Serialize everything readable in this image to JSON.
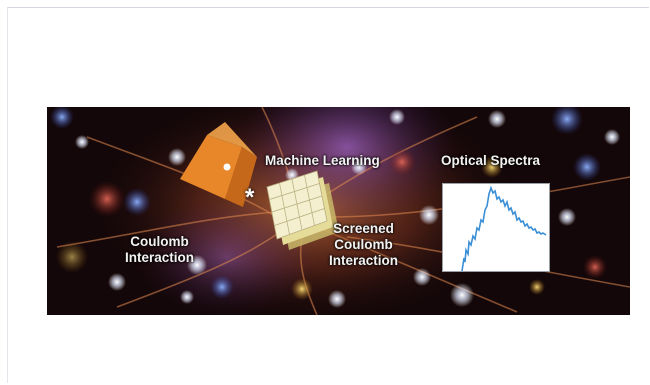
{
  "figure": {
    "labels": {
      "machine_learning": "Machine Learning",
      "optical_spectra": "Optical Spectra",
      "coulomb_interaction": "Coulomb\nInteraction",
      "screened_coulomb_interaction": "Screened\nCoulomb\nInteraction",
      "operator": "*"
    },
    "colors": {
      "cube": "#e8862a",
      "grid_tile": "#f3efcf",
      "spectrum_line": "#3a8fd6"
    },
    "icons": [
      "orange-cube-icon",
      "stacked-grid-icon",
      "spectrum-plot-icon"
    ]
  }
}
